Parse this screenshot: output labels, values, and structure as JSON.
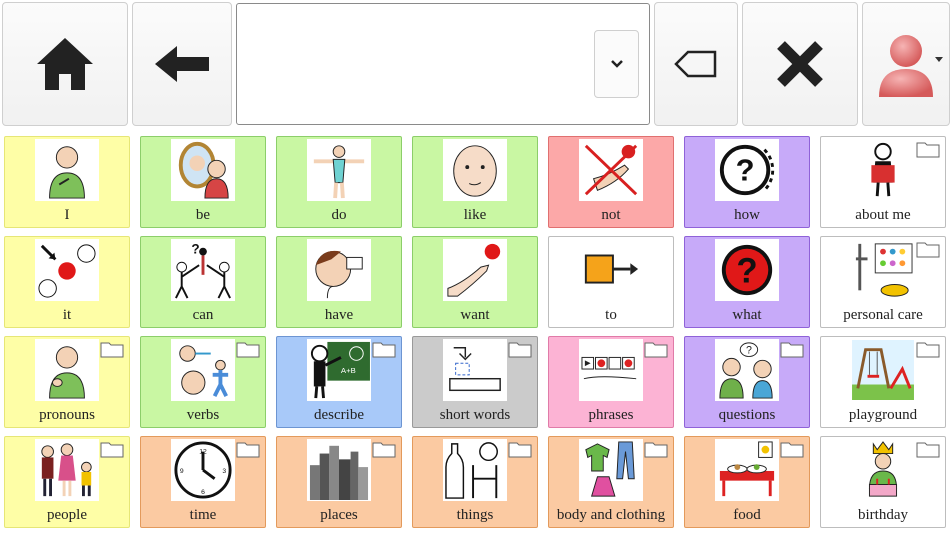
{
  "toolbar": {
    "home": "home-icon",
    "back": "arrow-left-icon",
    "message_text": "",
    "dropdown": "chevron-down-icon",
    "backspace": "backspace-icon",
    "clear": "close-icon",
    "user": "user-avatar-icon"
  },
  "colors": {
    "yellow": "#fefea6",
    "green": "#c9f7a3",
    "red": "#fca8a8",
    "purple": "#c7aaf9",
    "white": "#ffffff",
    "blue": "#a8c9f9",
    "gray": "#cbcbcb",
    "pink": "#fcb3d4",
    "orange": "#fbcaa2"
  },
  "grid": [
    {
      "label": "I",
      "color": "yellow",
      "icon": "person-pointing-self-icon",
      "folder": false
    },
    {
      "label": "be",
      "color": "green",
      "icon": "mirror-reflection-icon",
      "folder": false
    },
    {
      "label": "do",
      "color": "green",
      "icon": "person-arms-out-icon",
      "folder": false
    },
    {
      "label": "like",
      "color": "green",
      "icon": "face-icon",
      "folder": false
    },
    {
      "label": "not",
      "color": "red",
      "icon": "crossed-hand-icon",
      "folder": false
    },
    {
      "label": "how",
      "color": "purple",
      "icon": "question-circle-icon",
      "folder": false
    },
    {
      "label": "about me",
      "color": "white",
      "icon": "person-holding-card-icon",
      "folder": true
    },
    {
      "label": "it",
      "color": "yellow",
      "icon": "arrow-dot-icon",
      "folder": false
    },
    {
      "label": "can",
      "color": "green",
      "icon": "people-lifting-icon",
      "folder": false
    },
    {
      "label": "have",
      "color": "green",
      "icon": "person-drinking-icon",
      "folder": false
    },
    {
      "label": "want",
      "color": "green",
      "icon": "hand-reaching-icon",
      "folder": false
    },
    {
      "label": "to",
      "color": "white",
      "icon": "square-arrow-icon",
      "folder": false
    },
    {
      "label": "what",
      "color": "purple",
      "icon": "red-question-icon",
      "folder": false
    },
    {
      "label": "personal care",
      "color": "white",
      "icon": "care-items-icon",
      "folder": true
    },
    {
      "label": "pronouns",
      "color": "yellow",
      "icon": "person-sign-icon",
      "folder": true
    },
    {
      "label": "verbs",
      "color": "green",
      "icon": "actions-icon",
      "folder": true
    },
    {
      "label": "describe",
      "color": "blue",
      "icon": "teacher-board-icon",
      "folder": true
    },
    {
      "label": "short words",
      "color": "gray",
      "icon": "short-words-icon",
      "folder": true
    },
    {
      "label": "phrases",
      "color": "pink",
      "icon": "sentence-strip-icon",
      "folder": true
    },
    {
      "label": "questions",
      "color": "purple",
      "icon": "two-people-talking-icon",
      "folder": true
    },
    {
      "label": "playground",
      "color": "white",
      "icon": "playground-icon",
      "folder": true
    },
    {
      "label": "people",
      "color": "yellow",
      "icon": "family-icon",
      "folder": true
    },
    {
      "label": "time",
      "color": "orange",
      "icon": "clock-icon",
      "folder": true
    },
    {
      "label": "places",
      "color": "orange",
      "icon": "city-icon",
      "folder": true
    },
    {
      "label": "things",
      "color": "orange",
      "icon": "bottle-ball-chair-icon",
      "folder": true
    },
    {
      "label": "body and clothing",
      "color": "orange",
      "icon": "clothes-icon",
      "folder": true
    },
    {
      "label": "food",
      "color": "orange",
      "icon": "food-table-icon",
      "folder": true
    },
    {
      "label": "birthday",
      "color": "white",
      "icon": "birthday-cake-icon",
      "folder": true
    }
  ]
}
